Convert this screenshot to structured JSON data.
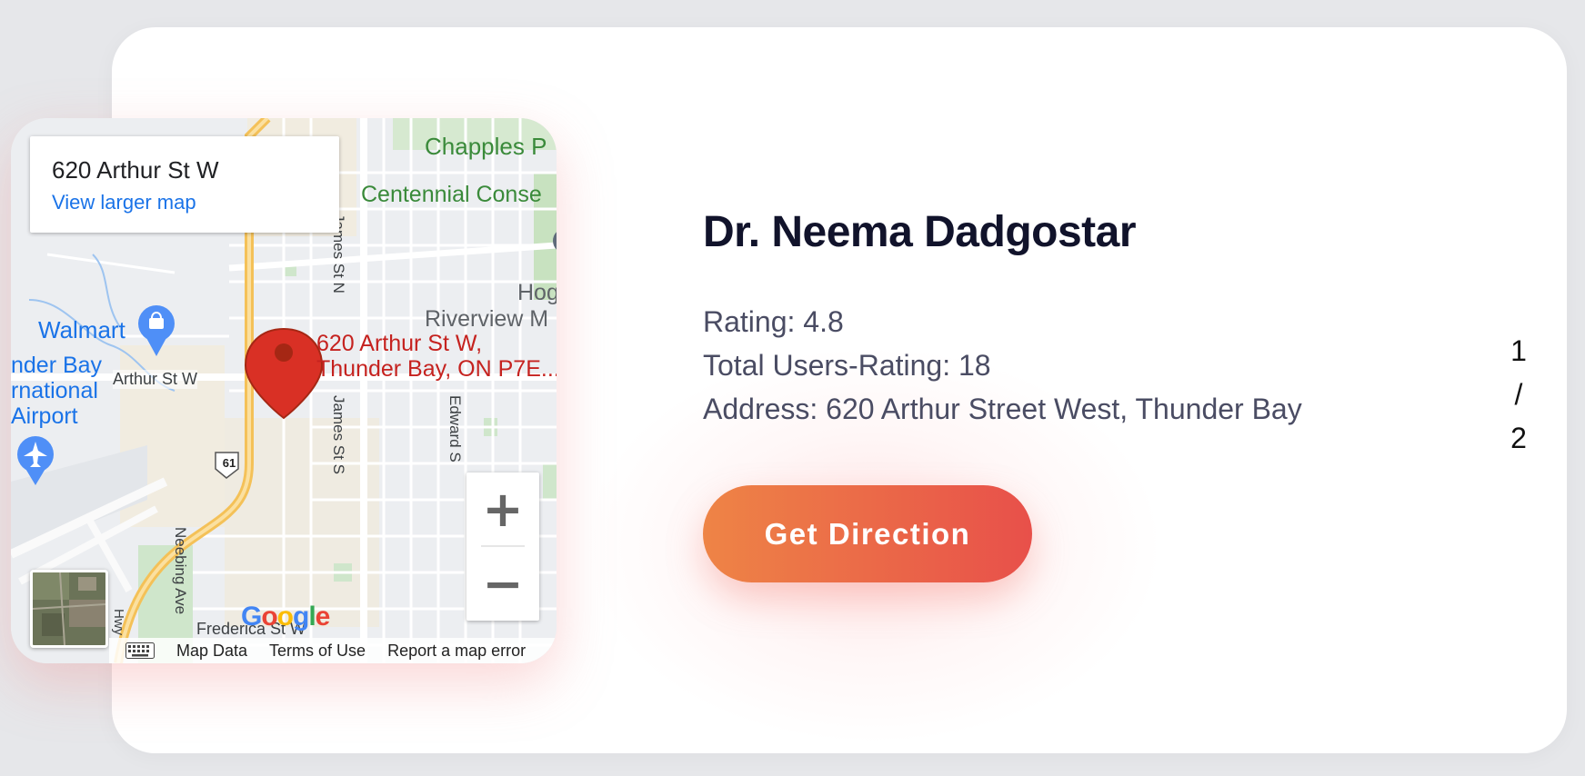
{
  "map": {
    "place_title": "620 Arthur St W",
    "view_larger_label": "View larger map",
    "marker_label_line1": "620 Arthur St W,",
    "marker_label_line2": "Thunder Bay, ON P7E...",
    "poi": {
      "walmart": "Walmart",
      "airport_line1": "nder Bay",
      "airport_line2": "rnational",
      "airport_line3": "Airport",
      "chapples": "Chapples P",
      "centennial": "Centennial Conse",
      "riverview": "Riverview M",
      "hog": "Hog"
    },
    "streets": {
      "arthur": "Arthur St W",
      "james_n": "James St N",
      "james_s": "James St S",
      "edward": "Edward S",
      "neebing": "Neebing Ave",
      "frederica": "Frederica St W",
      "hwy_61": "61",
      "hwy_side": "Hwy"
    },
    "footer": {
      "map_data": "Map Data",
      "terms": "Terms of Use",
      "report": "Report a map error"
    },
    "google_logo": [
      "G",
      "o",
      "o",
      "g",
      "l",
      "e"
    ],
    "google_colors": [
      "#4285f4",
      "#ea4335",
      "#fbbc05",
      "#4285f4",
      "#34a853",
      "#ea4335"
    ],
    "zoom_in": "+",
    "zoom_out": "−"
  },
  "doctor": {
    "name": "Dr. Neema Dadgostar",
    "rating": "Rating: 4.8",
    "total_ratings": "Total Users-Rating: 18",
    "address": "Address: 620 Arthur Street West, Thunder Bay"
  },
  "cta_label": "Get Direction",
  "pager": {
    "current": "1",
    "separator": "/",
    "total": "2"
  },
  "colors": {
    "gradient_start": "#ee8446",
    "gradient_end": "#e8504a",
    "marker": "#d93025",
    "link": "#1a73e8"
  }
}
